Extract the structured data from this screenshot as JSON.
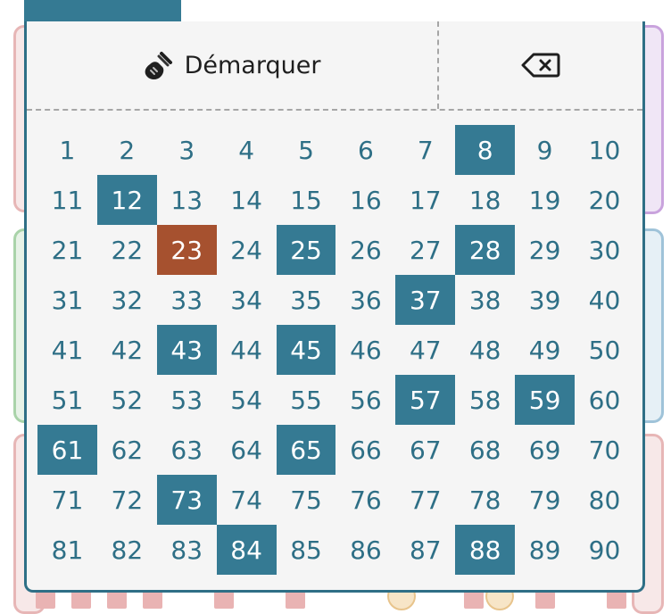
{
  "colors": {
    "accent": "#357a93",
    "marked_bg": "#357a93",
    "current_bg": "#a6512f",
    "number_text": "#2e6f86",
    "popup_border": "#2f6f86",
    "popup_bg": "#f5f5f5",
    "divider": "#a6a6a6"
  },
  "icons": {
    "unmark": "broom-icon",
    "backspace": "backspace-icon"
  },
  "actions": {
    "unmark_label": "Démarquer"
  },
  "board": {
    "current": 23,
    "marked": [
      8,
      12,
      25,
      28,
      37,
      43,
      45,
      57,
      59,
      61,
      65,
      73,
      84,
      88
    ],
    "numbers": [
      "1",
      "2",
      "3",
      "4",
      "5",
      "6",
      "7",
      "8",
      "9",
      "10",
      "11",
      "12",
      "13",
      "14",
      "15",
      "16",
      "17",
      "18",
      "19",
      "20",
      "21",
      "22",
      "23",
      "24",
      "25",
      "26",
      "27",
      "28",
      "29",
      "30",
      "31",
      "32",
      "33",
      "34",
      "35",
      "36",
      "37",
      "38",
      "39",
      "40",
      "41",
      "42",
      "43",
      "44",
      "45",
      "46",
      "47",
      "48",
      "49",
      "50",
      "51",
      "52",
      "53",
      "54",
      "55",
      "56",
      "57",
      "58",
      "59",
      "60",
      "61",
      "62",
      "63",
      "64",
      "65",
      "66",
      "67",
      "68",
      "69",
      "70",
      "71",
      "72",
      "73",
      "74",
      "75",
      "76",
      "77",
      "78",
      "79",
      "80",
      "81",
      "82",
      "83",
      "84",
      "85",
      "86",
      "87",
      "88",
      "89",
      "90"
    ]
  }
}
